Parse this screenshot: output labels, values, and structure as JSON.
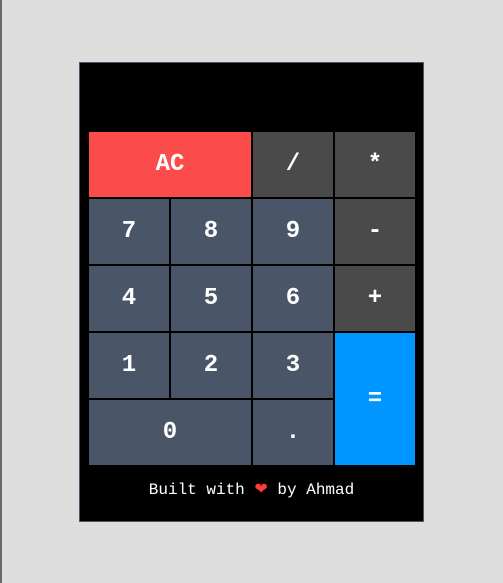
{
  "display": {
    "value": ""
  },
  "keys": {
    "clear": "AC",
    "divide": "/",
    "multiply": "*",
    "seven": "7",
    "eight": "8",
    "nine": "9",
    "subtract": "-",
    "four": "4",
    "five": "5",
    "six": "6",
    "add": "+",
    "one": "1",
    "two": "2",
    "three": "3",
    "equals": "=",
    "zero": "0",
    "decimal": "."
  },
  "footer": {
    "prefix": "Built with",
    "heart": "❤",
    "suffix": "by Ahmad"
  },
  "colors": {
    "page_background": "#dddddd",
    "calculator_background": "#000000",
    "number_key": "#4a5568",
    "operator_key": "#4a4a4a",
    "clear_key": "#fc4b4b",
    "equals_key": "#0096ff",
    "key_text": "#ffffff",
    "heart": "#ff3b3b"
  }
}
